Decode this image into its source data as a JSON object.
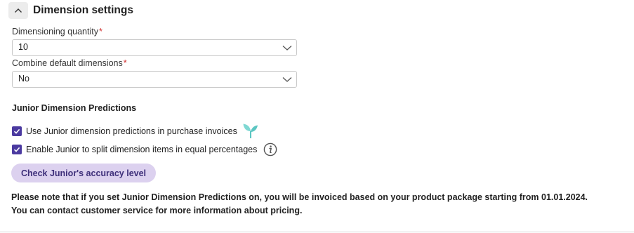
{
  "section": {
    "title": "Dimension settings",
    "collapse_icon": "chevron-up-icon"
  },
  "dimensioning_quantity": {
    "label": "Dimensioning quantity",
    "required_marker": "*",
    "value": "10"
  },
  "combine_default_dimensions": {
    "label": "Combine default dimensions",
    "required_marker": "*",
    "value": "No"
  },
  "junior": {
    "heading": "Junior Dimension Predictions",
    "checkboxes": [
      {
        "label": "Use Junior dimension predictions in purchase invoices",
        "checked": true,
        "icon": "sprout-leaf-icon"
      },
      {
        "label": "Enable Junior to split dimension items in equal percentages",
        "checked": true,
        "icon": "info-icon"
      }
    ],
    "accuracy_button": "Check Junior's accuracy level",
    "note_line1": "Please note that if you set Junior Dimension Predictions on, you will be invoiced based on your product package starting from 01.01.2024.",
    "note_line2": "You can contact customer service for more information about pricing."
  },
  "colors": {
    "checkbox": "#4b3aa0",
    "button_bg": "#dcd1ef",
    "button_text": "#3e2f7a",
    "required": "#d0302f",
    "leaf": "#5cc6c2"
  }
}
